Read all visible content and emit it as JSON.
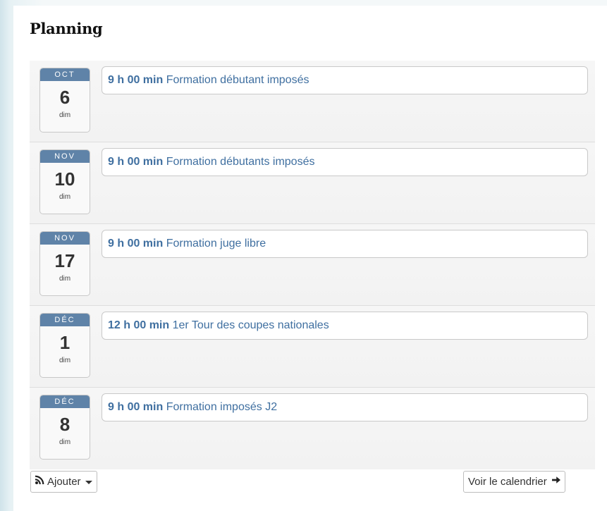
{
  "widget": {
    "title": "Planning"
  },
  "events": [
    {
      "month": "OCT",
      "day": "6",
      "dow": "dim",
      "time": "9 h 00 min",
      "name": "Formation débutant imposés"
    },
    {
      "month": "NOV",
      "day": "10",
      "dow": "dim",
      "time": "9 h 00 min",
      "name": "Formation débutants imposés"
    },
    {
      "month": "NOV",
      "day": "17",
      "dow": "dim",
      "time": "9 h 00 min",
      "name": "Formation juge libre"
    },
    {
      "month": "DÉC",
      "day": "1",
      "dow": "dim",
      "time": "12 h 00 min",
      "name": "1er Tour des coupes nationales"
    },
    {
      "month": "DÉC",
      "day": "8",
      "dow": "dim",
      "time": "9 h 00 min",
      "name": "Formation imposés J2"
    }
  ],
  "footer": {
    "add_label": "Ajouter",
    "add_icon": "rss-icon",
    "calendar_label": "Voir le calendrier",
    "calendar_icon": "arrow-right-icon"
  },
  "colors": {
    "month_band": "#5f83a8",
    "event_link": "#3f6fa0"
  }
}
